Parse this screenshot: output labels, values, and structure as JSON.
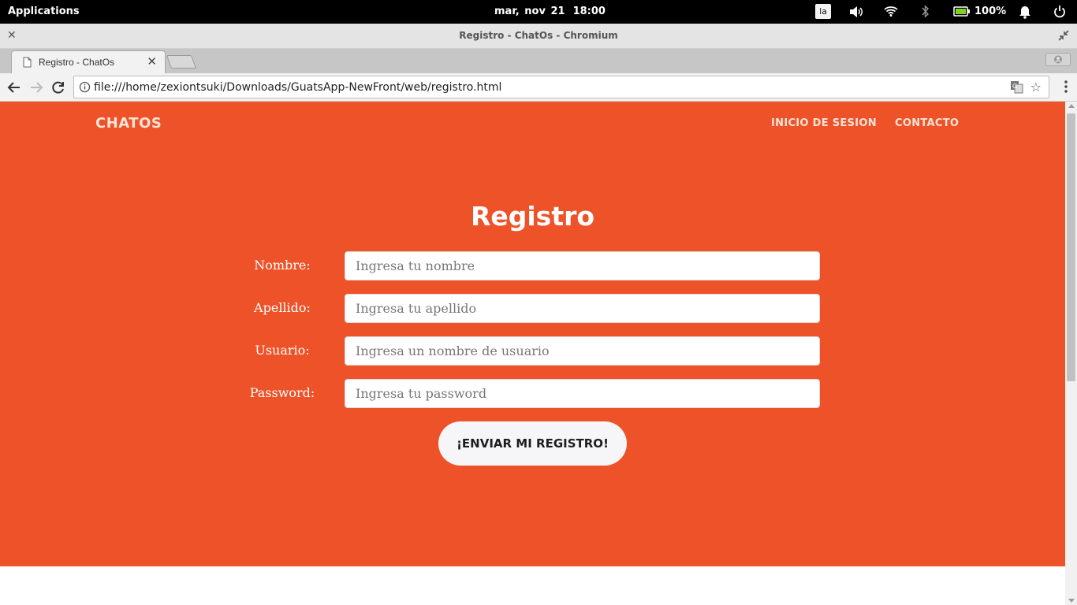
{
  "os_panel": {
    "applications_label": "Applications",
    "date": "mar, nov 21",
    "time": "18:00",
    "keyboard_layout": "la",
    "battery_percent": "100%",
    "icons": [
      "volume-icon",
      "wifi-icon",
      "bluetooth-icon",
      "battery-icon",
      "notification-bell-icon",
      "power-icon"
    ]
  },
  "window": {
    "title": "Registro - ChatOs - Chromium"
  },
  "browser": {
    "tab_title": "Registro - ChatOs",
    "url": "file:///home/zexiontsuki/Downloads/GuatsApp-NewFront/web/registro.html"
  },
  "site": {
    "brand": "CHATOS",
    "nav": [
      "INICIO DE SESION",
      "CONTACTO"
    ],
    "accent_color": "#ee5228"
  },
  "form": {
    "title": "Registro",
    "fields": [
      {
        "label": "Nombre:",
        "placeholder": "Ingresa tu nombre",
        "value": ""
      },
      {
        "label": "Apellido:",
        "placeholder": "Ingresa tu apellido",
        "value": ""
      },
      {
        "label": "Usuario:",
        "placeholder": "Ingresa un nombre de usuario",
        "value": ""
      },
      {
        "label": "Password:",
        "placeholder": "Ingresa tu password",
        "value": ""
      }
    ],
    "submit_label": "¡ENVIAR MI REGISTRO!"
  }
}
